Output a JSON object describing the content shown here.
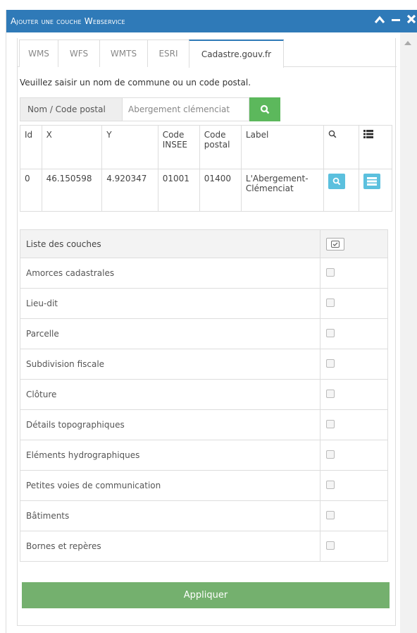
{
  "window": {
    "title": "Ajouter une couche Webservice",
    "controls": [
      "chevron-up-icon",
      "minimize-icon",
      "close-icon"
    ],
    "accent": "#2f7ab8"
  },
  "tabs": [
    {
      "label": "WMS",
      "active": false
    },
    {
      "label": "WFS",
      "active": false
    },
    {
      "label": "WMTS",
      "active": false
    },
    {
      "label": "ESRI",
      "active": false
    },
    {
      "label": "Cadastre.gouv.fr",
      "active": true
    }
  ],
  "search": {
    "prompt": "Veuillez saisir un nom de commune ou un code postal.",
    "addon_label": "Nom / Code postal",
    "value": "Abergement clémenciat",
    "button_icon": "search-icon",
    "button_color": "#5cb85c"
  },
  "results": {
    "headers": [
      "Id",
      "X",
      "Y",
      "Code INSEE",
      "Code postal",
      "Label"
    ],
    "header_icons": [
      "search-icon",
      "list-icon"
    ],
    "rows": [
      {
        "id": "0",
        "x": "46.150598",
        "y": "4.920347",
        "insee": "01001",
        "postal": "01400",
        "label": "L'Abergement-Clémenciat"
      }
    ],
    "action_color": "#5bc0de"
  },
  "layers": {
    "header": "Liste des couches",
    "items": [
      {
        "label": "Amorces cadastrales",
        "checked": false
      },
      {
        "label": "Lieu-dit",
        "checked": false
      },
      {
        "label": "Parcelle",
        "checked": false
      },
      {
        "label": "Subdivision fiscale",
        "checked": false
      },
      {
        "label": "Clôture",
        "checked": false
      },
      {
        "label": "Détails topographiques",
        "checked": false
      },
      {
        "label": "Eléments hydrographiques",
        "checked": false
      },
      {
        "label": "Petites voies de communication",
        "checked": false
      },
      {
        "label": "Bâtiments",
        "checked": false
      },
      {
        "label": "Bornes et repères",
        "checked": false
      }
    ]
  },
  "apply_label": "Appliquer",
  "apply_color": "#74b06e"
}
